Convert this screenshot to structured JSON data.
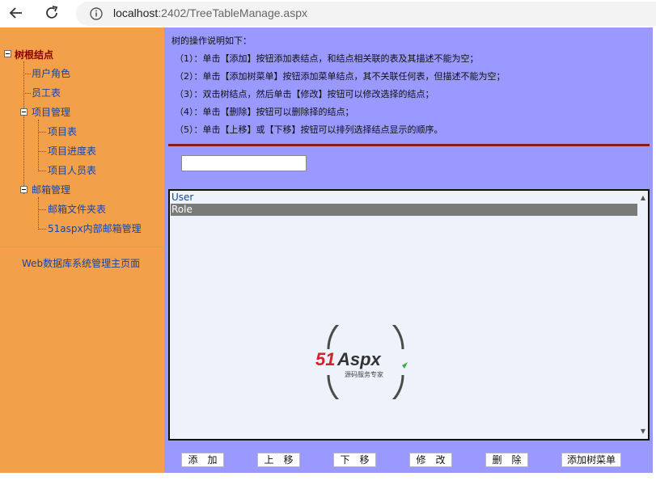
{
  "browser": {
    "url_host": "localhost",
    "url_path": ":2402/TreeTableManage.aspx"
  },
  "tree": {
    "root": "树根结点",
    "items": [
      {
        "label": "用户角色"
      },
      {
        "label": "员工表"
      },
      {
        "label": "项目管理"
      },
      {
        "label": "项目表"
      },
      {
        "label": "项目进度表"
      },
      {
        "label": "项目人员表"
      },
      {
        "label": "邮箱管理"
      },
      {
        "label": "邮箱文件夹表"
      },
      {
        "label": "51aspx内部邮箱管理"
      }
    ],
    "main_link": "Web数据库系统管理主页面"
  },
  "instructions": {
    "title": "树的操作说明如下：",
    "lines": [
      "（1）：单击【添加】按钮添加表结点，和结点相关联的表及其描述不能为空；",
      "（2）：单击【添加树菜单】按钮添加菜单结点，其不关联任何表，但描述不能为空；",
      "（3）：双击树结点，然后单击【修改】按钮可以修改选择的结点；",
      "（4）：单击【删除】按钮可以删除择的结点；",
      "（5）：单击【上移】或【下移】按钮可以排列选择结点显示的顺序。"
    ]
  },
  "input": {
    "value": ""
  },
  "listbox": {
    "options": [
      "User",
      "Role"
    ],
    "selected": "Role"
  },
  "watermark": {
    "brand_51": "51",
    "brand_aspx": "Aspx",
    "slogan": "源码服务专家"
  },
  "buttons": {
    "add": "添　加",
    "up": "上　移",
    "down": "下　移",
    "edit": "修　改",
    "delete": "删　除",
    "add_menu": "添加树菜单"
  },
  "colors": {
    "left_bg": "#f3a04a",
    "right_bg": "#9999ff",
    "separator": "#8b1a1a",
    "selected_row": "#7a7a7a"
  }
}
